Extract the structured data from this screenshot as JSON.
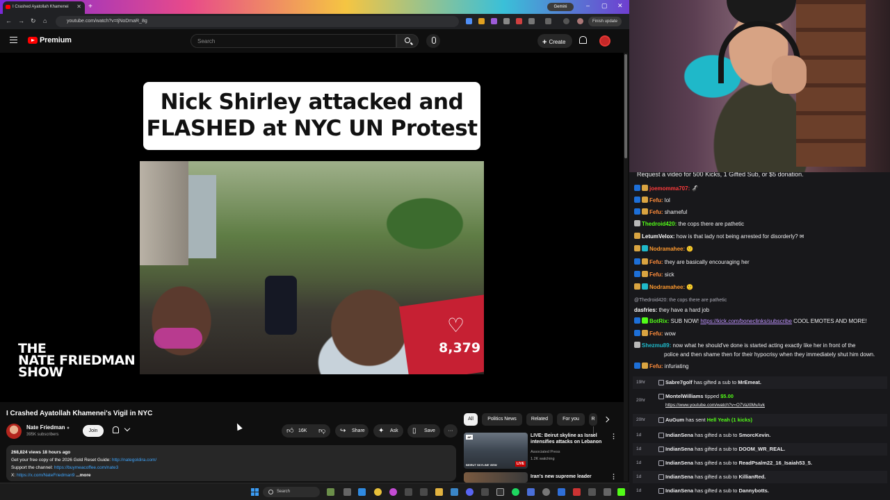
{
  "browser": {
    "tab_title": "I Crashed Ayatollah Khamenei",
    "new_tab": "+",
    "gemini": "Gemini",
    "url": "youtube.com/watch?v=tjNoDmaR_8g",
    "finish_update": "Finish update",
    "controls": [
      "–",
      "▢",
      "✕"
    ]
  },
  "youtube": {
    "brand": "Premium",
    "search_placeholder": "Search",
    "create_label": "Create"
  },
  "video": {
    "overlay_title": "Nick Shirley attacked and FLASHED at NYC UN Protest",
    "like_count_overlay": "8,379",
    "show_logo": [
      "THE",
      "NATE FRIEDMAN",
      "SHOW"
    ],
    "title": "I Crashed Ayatollah Khamenei's Vigil in NYC",
    "channel": "Nate Friedman",
    "subscribers": "395K subscribers",
    "join": "Join",
    "likes": "16K",
    "share": "Share",
    "ask": "Ask",
    "save": "Save",
    "more": "···",
    "description": {
      "meta": "268,824 views  18 hours ago",
      "line1_text": "Get your free copy of the 2026 Gold Reset Guide: ",
      "line1_link": "http://nategoldira.com/",
      "line2_text": "Support the channel: ",
      "line2_link": "https://buymeacoffee.com/nate3",
      "line3_text": "X: ",
      "line3_link": "https://x.com/NateFriedman9",
      "more": "...more"
    }
  },
  "chips": [
    "All",
    "Politics News",
    "Related",
    "For you",
    "R"
  ],
  "recommendations": [
    {
      "title": "LIVE: Beirut skyline as Israel intensifies attacks on Lebanon",
      "channel": "Associated Press",
      "meta": "1.2K watching",
      "thumb_label": "AP",
      "thumb_caption": "BEIRUT SKYLINE VIEW",
      "badge": "LIVE"
    },
    {
      "title": "Iran's new supreme leader",
      "channel": "",
      "meta": ""
    }
  ],
  "taskbar": {
    "search": "Search"
  },
  "chat": {
    "top_text": "Request a video for 500 Kicks, 1 Gifted Sub, or $5 donation.",
    "messages": [
      {
        "user": "joemomma707:",
        "text": " 🦨",
        "color": "#ff3b3b",
        "badges": [
          "k",
          "b"
        ]
      },
      {
        "user": "Fefu:",
        "text": " lol",
        "color": "#ff8c3b",
        "badges": [
          "k",
          "b"
        ]
      },
      {
        "user": "Fefu:",
        "text": " shameful",
        "color": "#ff8c3b",
        "badges": [
          "k",
          "b"
        ]
      },
      {
        "user": "Thedroid420:",
        "text": " the cops there are pathetic",
        "color": "#53fc18",
        "badges": [
          "s"
        ]
      },
      {
        "user": "LetumVelox:",
        "text": " how is that lady not being arrested for disorderly? ✉",
        "color": "#ffffff",
        "badges": [
          "b"
        ]
      },
      {
        "user": "Nodramahee:",
        "text": " 🙂",
        "color": "#ff9a2e",
        "badges": [
          "b",
          "c"
        ]
      },
      {
        "user": "Fefu:",
        "text": " they are basically encouraging her",
        "color": "#ff8c3b",
        "badges": [
          "k",
          "b"
        ]
      },
      {
        "user": "Fefu:",
        "text": " sick",
        "color": "#ff8c3b",
        "badges": [
          "k",
          "b"
        ]
      },
      {
        "user": "Nodramahee:",
        "text": " 🙂",
        "color": "#ff9a2e",
        "badges": [
          "b",
          "c"
        ]
      },
      {
        "user": "",
        "text": "@Thedroid420: the cops there are pathetic",
        "color": "#adadb8",
        "badges": [],
        "reply": true
      },
      {
        "user": "dasfries:",
        "text": " they have a hard job",
        "color": "#ffffff",
        "badges": []
      },
      {
        "user": "BotRix:",
        "text": " SUB NOW! ",
        "link": "https://kick.com/boneclinks/subscribe",
        "tail": " COOL EMOTES AND MORE!",
        "color": "#53fc18",
        "badges": [
          "k",
          "g"
        ]
      },
      {
        "user": "Fefu:",
        "text": " wow",
        "color": "#ff8c3b",
        "badges": [
          "k",
          "b"
        ]
      },
      {
        "user": "Shezmu89:",
        "text": " now what he should've done is started acting exactly like her in front of the",
        "color": "#1fb8c9",
        "badges": [
          "s"
        ]
      },
      {
        "user": "",
        "text": "police and then shame then for their hypocrisy when they immediately shut him down.",
        "color": "#efeff1",
        "badges": [],
        "cont": true
      },
      {
        "user": "Fefu:",
        "text": " infuriating",
        "color": "#ff8c3b",
        "badges": [
          "k",
          "b"
        ]
      }
    ],
    "events": [
      {
        "time": "19hr",
        "user": "Sabre7golf",
        "text": " has gifted a sub to ",
        "target": "MrEmeat."
      },
      {
        "time": "20hr",
        "user": "MontelWilliams",
        "text": " tipped ",
        "green": "$5.00",
        "sub": "https://www.youtube.com/watch?v=O7VaXlMvAvk"
      },
      {
        "time": "20hr",
        "user": "AuGum",
        "text": " has sent ",
        "green": "Hell Yeah (1 kicks)"
      },
      {
        "time": "1d",
        "user": "IndianSena",
        "text": " has gifted a sub to ",
        "target": "SmorcKevin."
      },
      {
        "time": "1d",
        "user": "IndianSena",
        "text": " has gifted a sub to ",
        "target": "DOOM_WR_REAL."
      },
      {
        "time": "1d",
        "user": "IndianSena",
        "text": " has gifted a sub to ",
        "target": "ReadPsalm22_16_Isaiah53_5."
      },
      {
        "time": "1d",
        "user": "IndianSena",
        "text": " has gifted a sub to ",
        "target": "KillianRed."
      },
      {
        "time": "1d",
        "user": "IndianSena",
        "text": " has gifted a sub to ",
        "target": "Dannybotts."
      }
    ]
  },
  "colors": {
    "youtube_red": "#ff0000",
    "link_blue": "#3ea6ff",
    "kick_green": "#53fc18",
    "chat_bg": "#18181b"
  }
}
